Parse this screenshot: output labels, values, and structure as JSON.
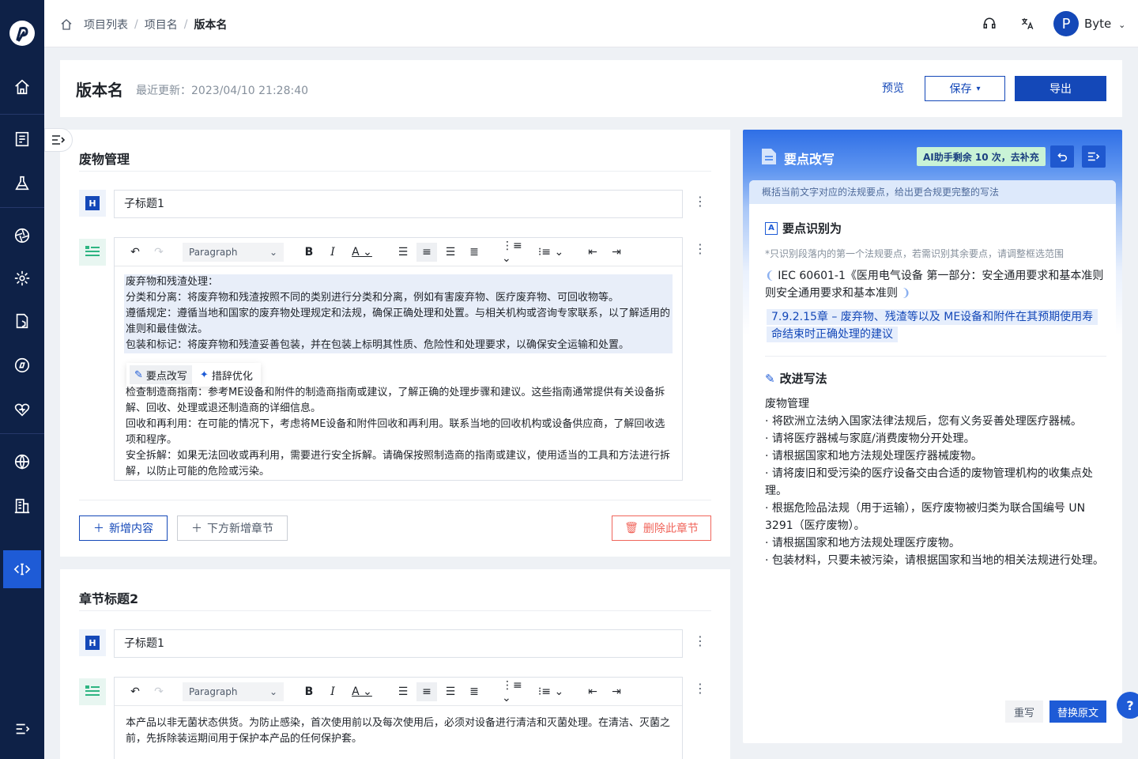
{
  "breadcrumb": [
    "项目列表",
    "项目名",
    "版本名"
  ],
  "user": {
    "initial": "P",
    "name": "Byte"
  },
  "header": {
    "title": "版本名",
    "updated": "最近更新：2023/04/10 21:28:40",
    "preview": "预览",
    "save": "保存",
    "export": "导出"
  },
  "section1": {
    "title": "废物管理",
    "subtitle": "子标题1",
    "paragraph_select": "Paragraph",
    "highlighted": [
      "废弃物和残渣处理：",
      "分类和分离：将废弃物和残渣按照不同的类别进行分类和分离，例如有害废弃物、医疗废弃物、可回收物等。",
      "遵循规定：遵循当地和国家的废弃物处理规定和法规，确保正确处理和处置。与相关机构或咨询专家联系，以了解适用的准则和最佳做法。",
      "包装和标记：将废弃物和残渣妥善包装，并在包装上标明其性质、危险性和处理要求，以确保安全运输和处置。"
    ],
    "popup": {
      "opt1": "要点改写",
      "opt2": "措辞优化"
    },
    "body": [
      "检查制造商指南：参考ME设备和附件的制造商指南或建议，了解正确的处理步骤和建议。这些指南通常提供有关设备拆解、回收、处理或退还制造商的详细信息。",
      "回收和再利用：在可能的情况下，考虑将ME设备和附件回收和再利用。联系当地的回收机构或设备供应商，了解回收选项和程序。",
      "安全拆解：如果无法回收或再利用，需要进行安全拆解。请确保按照制造商的指南或建议，使用适当的工具和方法进行拆解，以防止可能的危险或污染。"
    ],
    "add_content": "新增内容",
    "add_section": "下方新增章节",
    "delete_section": "删除此章节"
  },
  "section2": {
    "title": "章节标题2",
    "subtitle": "子标题1",
    "paragraph_select": "Paragraph",
    "body": "本产品以非无菌状态供货。为防止感染，首次使用前以及每次使用后，必须对设备进行清洁和灭菌处理。在清洁、灭菌之前，先拆除装运期间用于保护本产品的任何保护套。"
  },
  "ai_panel": {
    "title": "要点改写",
    "quota": "AI助手剩余 10 次，去补充",
    "description": "概括当前文字对应的法规要点，给出更合规更完整的写法",
    "identify_title": "要点识别为",
    "identify_note": "*只识别段落内的第一个法规要点，若需识别其余要点，请调整框选范围",
    "standard": "IEC 60601-1《医用电气设备 第一部分：安全通用要求和基本准则则安全通用要求和基本准则",
    "clause": "7.9.2.15章 – 废弃物、残渣等以及 ME设备和附件在其预期使用寿命结束时正确处理的建议",
    "improve_title": "改进写法",
    "result_title": "废物管理",
    "result_items": [
      "· 将欧洲立法纳入国家法律法规后，您有义务妥善处理医疗器械。",
      "· 请将医疗器械与家庭/消费废物分开处理。",
      "· 请根据国家和地方法规处理医疗器械废物。",
      "· 请将废旧和受污染的医疗设备交由合适的废物管理机构的收集点处理。",
      "· 根据危险品法规（用于运输），医疗废物被归类为联合国编号 UN 3291（医疗废物）。",
      "· 请根据国家和地方法规处理医疗废物。",
      "· 包装材料，只要未被污染，请根据国家和当地的相关法规进行处理。"
    ],
    "rewrite": "重写",
    "replace": "替换原文"
  },
  "help": "?",
  "colors": {
    "primary": "#1448b8",
    "sidebar": "#0e2147",
    "danger": "#f0655b",
    "quota_bg": "#c9f3d6"
  }
}
